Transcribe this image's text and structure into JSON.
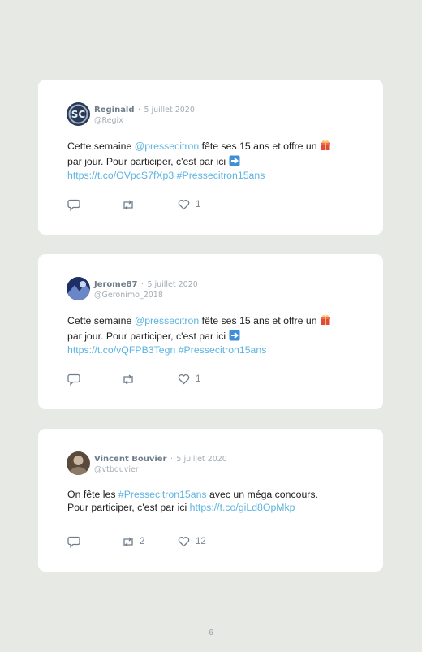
{
  "tweets": [
    {
      "name": "Reginald",
      "separator": "·",
      "date": "5 juillet 2020",
      "handle": "@Regix",
      "text_1": "Cette semaine ",
      "mention": "@pressecitron",
      "text_2": " fête ses 15 ans et offre un ",
      "text_3": " par jour. Pour participer, c'est par ici ",
      "url": "https://t.co/OVpcS7fXp3",
      "hashtag": "#Pressecitron15ans",
      "retweets": "",
      "likes": "1",
      "avatar_colors": [
        "#2a3a55",
        "#9fb0c8"
      ]
    },
    {
      "name": "Jerome87",
      "separator": "·",
      "date": "5 juillet 2020",
      "handle": "@Geronimo_2018",
      "text_1": "Cette semaine ",
      "mention": "@pressecitron",
      "text_2": " fête ses 15 ans et offre un ",
      "text_3": " par jour. Pour participer, c'est par ici ",
      "url": "https://t.co/vQFPB3Tegn",
      "hashtag": "#Pressecitron15ans",
      "retweets": "",
      "likes": "1",
      "avatar_colors": [
        "#1d2f66",
        "#6a86c6"
      ]
    },
    {
      "name": "Vincent Bouvier",
      "separator": "·",
      "date": "5 juillet 2020",
      "handle": "@vtbouvier",
      "text_1": "On fête les ",
      "hashtag": "#Pressecitron15ans",
      "text_2": " avec un méga concours.",
      "text_3": "Pour participer, c'est par ici ",
      "url": "https://t.co/giLd8OpMkp",
      "retweets": "2",
      "likes": "12",
      "avatar_colors": [
        "#5a4a3c",
        "#c9b7a2"
      ]
    }
  ],
  "icons": {
    "reply": "reply-icon",
    "retweet": "retweet-icon",
    "like": "heart-icon",
    "gift": "gift-emoji-icon",
    "arrow": "right-arrow-emoji-icon"
  },
  "colors": {
    "background": "#e6e9e4",
    "card": "#ffffff",
    "link": "#5cb4e0",
    "name": "#6f7d8a",
    "muted": "#a3acb4"
  },
  "page_number": "6"
}
